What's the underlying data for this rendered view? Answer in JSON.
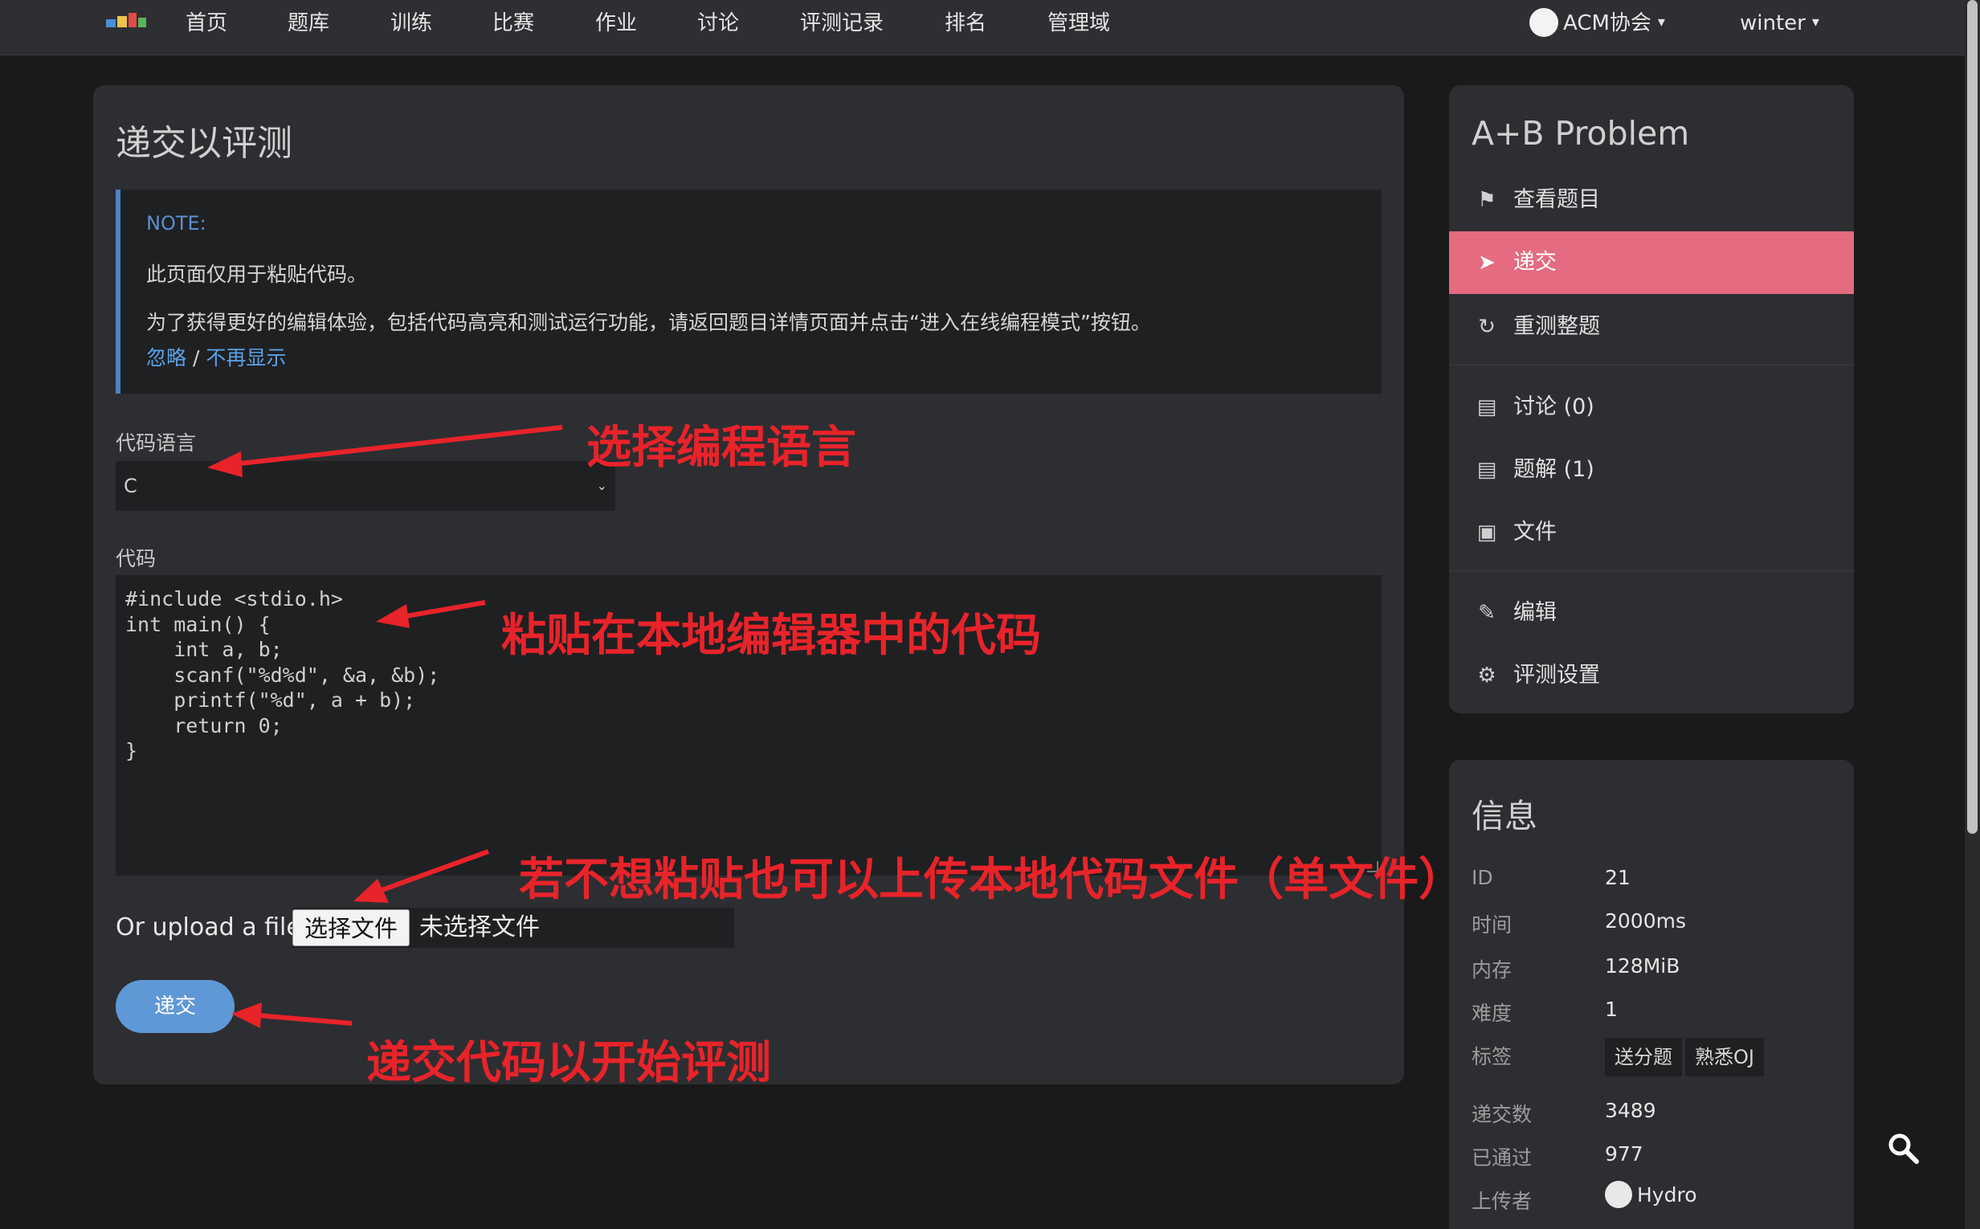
{
  "nav": {
    "items": [
      "首页",
      "题库",
      "训练",
      "比赛",
      "作业",
      "讨论",
      "评测记录",
      "排名",
      "管理域"
    ],
    "domain_label": "ACM协会",
    "user_label": "winter"
  },
  "main": {
    "title": "递交以评测",
    "note": {
      "title": "NOTE:",
      "line1": "此页面仅用于粘贴代码。",
      "line2": "为了获得更好的编辑体验，包括代码高亮和测试运行功能，请返回题目详情页面并点击“进入在线编程模式”按钮。",
      "ignore_link": "忽略",
      "separator": " / ",
      "never_show_link": "不再显示"
    },
    "lang_label": "代码语言",
    "lang_value": "C",
    "code_label": "代码",
    "code": "#include <stdio.h>\nint main() {\n    int a, b;\n    scanf(\"%d%d\", &a, &b);\n    printf(\"%d\", a + b);\n    return 0;\n}",
    "upload_label": "Or upload a file:",
    "file_button": "选择文件",
    "file_none": "未选择文件",
    "submit": "递交"
  },
  "annotations": {
    "lang": "选择编程语言",
    "code": "粘贴在本地编辑器中的代码",
    "upload": "若不想粘贴也可以上传本地代码文件（单文件）",
    "submit": "递交代码以开始评测",
    "color": "#e8232a"
  },
  "sidebar": {
    "problem_title": "A+B Problem",
    "menu": [
      {
        "label": "查看题目",
        "icon": "flag-icon"
      },
      {
        "label": "递交",
        "icon": "send-icon",
        "active": true
      },
      {
        "label": "重测整题",
        "icon": "refresh-icon"
      },
      {
        "label": "讨论 (0)",
        "icon": "comment-icon"
      },
      {
        "label": "题解 (1)",
        "icon": "comment-icon"
      },
      {
        "label": "文件",
        "icon": "image-file-icon"
      },
      {
        "label": "编辑",
        "icon": "pencil-icon"
      },
      {
        "label": "评测设置",
        "icon": "gear-icon"
      }
    ],
    "info": {
      "title": "信息",
      "id_key": "ID",
      "id_val": "21",
      "time_key": "时间",
      "time_val": "2000ms",
      "mem_key": "内存",
      "mem_val": "128MiB",
      "diff_key": "难度",
      "diff_val": "1",
      "tags_key": "标签",
      "tags": [
        "送分题",
        "熟悉OJ"
      ],
      "submit_key": "递交数",
      "submit_val": "3489",
      "ac_key": "已通过",
      "ac_val": "977",
      "uploader_key": "上传者",
      "uploader_val": "Hydro"
    }
  },
  "colors": {
    "accent": "#5f98d6",
    "active_menu": "#e46b80",
    "link": "#5aa2e8"
  }
}
